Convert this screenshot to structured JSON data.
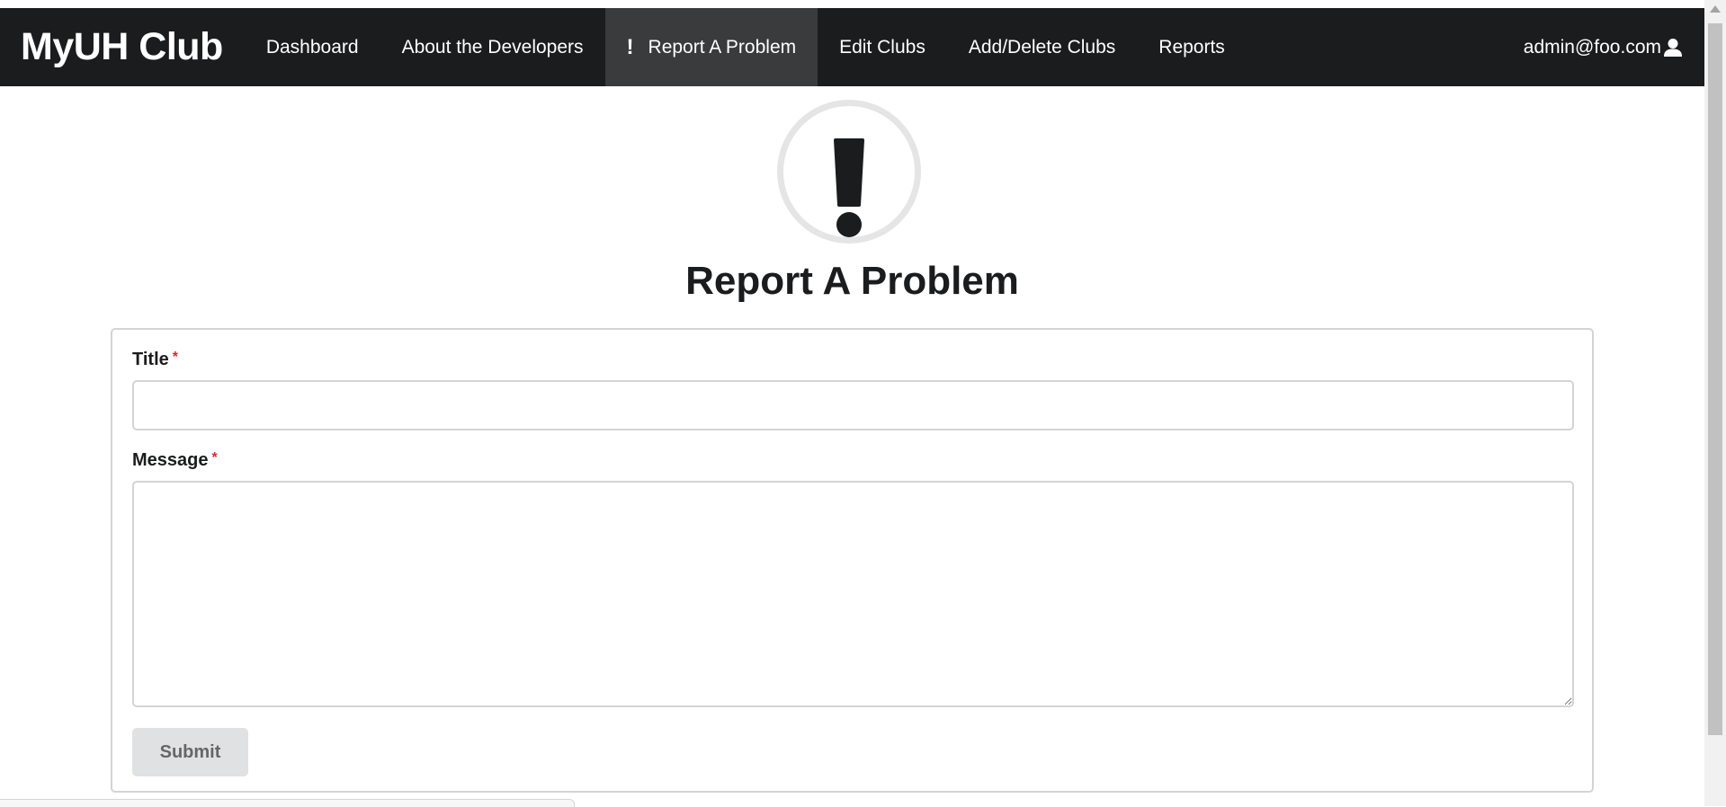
{
  "app": {
    "brand": "MyUH Club"
  },
  "nav": {
    "items": [
      {
        "label": "Dashboard"
      },
      {
        "label": "About the Developers"
      },
      {
        "label": "Report A Problem",
        "icon": "exclamation-icon",
        "active": true
      },
      {
        "label": "Edit Clubs"
      },
      {
        "label": "Add/Delete Clubs"
      },
      {
        "label": "Reports"
      }
    ],
    "active_icon_glyph": "!",
    "user": {
      "email": "admin@foo.com",
      "icon": "user-icon"
    }
  },
  "page": {
    "header_icon": "exclamation-icon",
    "title": "Report A Problem"
  },
  "form": {
    "title_label": "Title",
    "title_value": "",
    "message_label": "Message",
    "message_value": "",
    "required_marker": "*",
    "submit_label": "Submit"
  },
  "colors": {
    "navbar_bg": "#1b1c1d",
    "active_nav_bg": "#3a3b3c",
    "required": "#db2828",
    "button_bg": "#e0e1e2"
  }
}
